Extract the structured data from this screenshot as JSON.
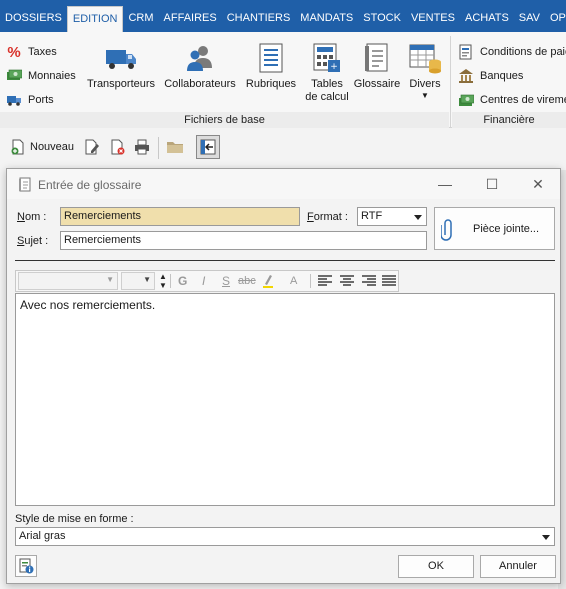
{
  "menu": {
    "tabs": [
      "DOSSIERS",
      "EDITION",
      "CRM",
      "AFFAIRES",
      "CHANTIERS",
      "MANDATS",
      "STOCK",
      "VENTES",
      "ACHATS",
      "SAV",
      "OPERA"
    ],
    "active": "EDITION"
  },
  "ribbon": {
    "left_items": [
      "Taxes",
      "Monnaies",
      "Ports"
    ],
    "big_buttons": {
      "transporteurs": "Transporteurs",
      "collaborateurs": "Collaborateurs",
      "rubriques": "Rubriques",
      "tables_line1": "Tables",
      "tables_line2": "de calcul",
      "glossaire": "Glossaire",
      "divers": "Divers"
    },
    "group_fichiers": "Fichiers de base",
    "right_items": [
      "Conditions de paie",
      "Banques",
      "Centres de viremen"
    ],
    "group_financiere": "Financière"
  },
  "toolbar": {
    "nouveau": "Nouveau"
  },
  "dialog": {
    "title": "Entrée de glossaire",
    "nom_label_u": "N",
    "nom_label_rest": "om :",
    "nom_value": "Remerciements",
    "format_label_u": "F",
    "format_label_rest": "ormat :",
    "format_value": "RTF",
    "piece_jointe": "Pièce jointe...",
    "sujet_label_u": "S",
    "sujet_label_rest": "ujet :",
    "sujet_value": "Remerciements",
    "editor_text": "Avec nos remerciements.",
    "fmt": {
      "bold": "G",
      "italic": "I",
      "underline": "S",
      "strike": "abc",
      "font_color": "A"
    },
    "style_label": "Style de mise en forme :",
    "style_value": "Arial gras",
    "ok": "OK",
    "cancel": "Annuler"
  },
  "colors": {
    "menubar": "#1f5fa8",
    "highlight_field": "#f0dfac",
    "icon_blue": "#2f6fb5",
    "taxes_red": "#d9322b",
    "money_green": "#3d8b3d"
  }
}
